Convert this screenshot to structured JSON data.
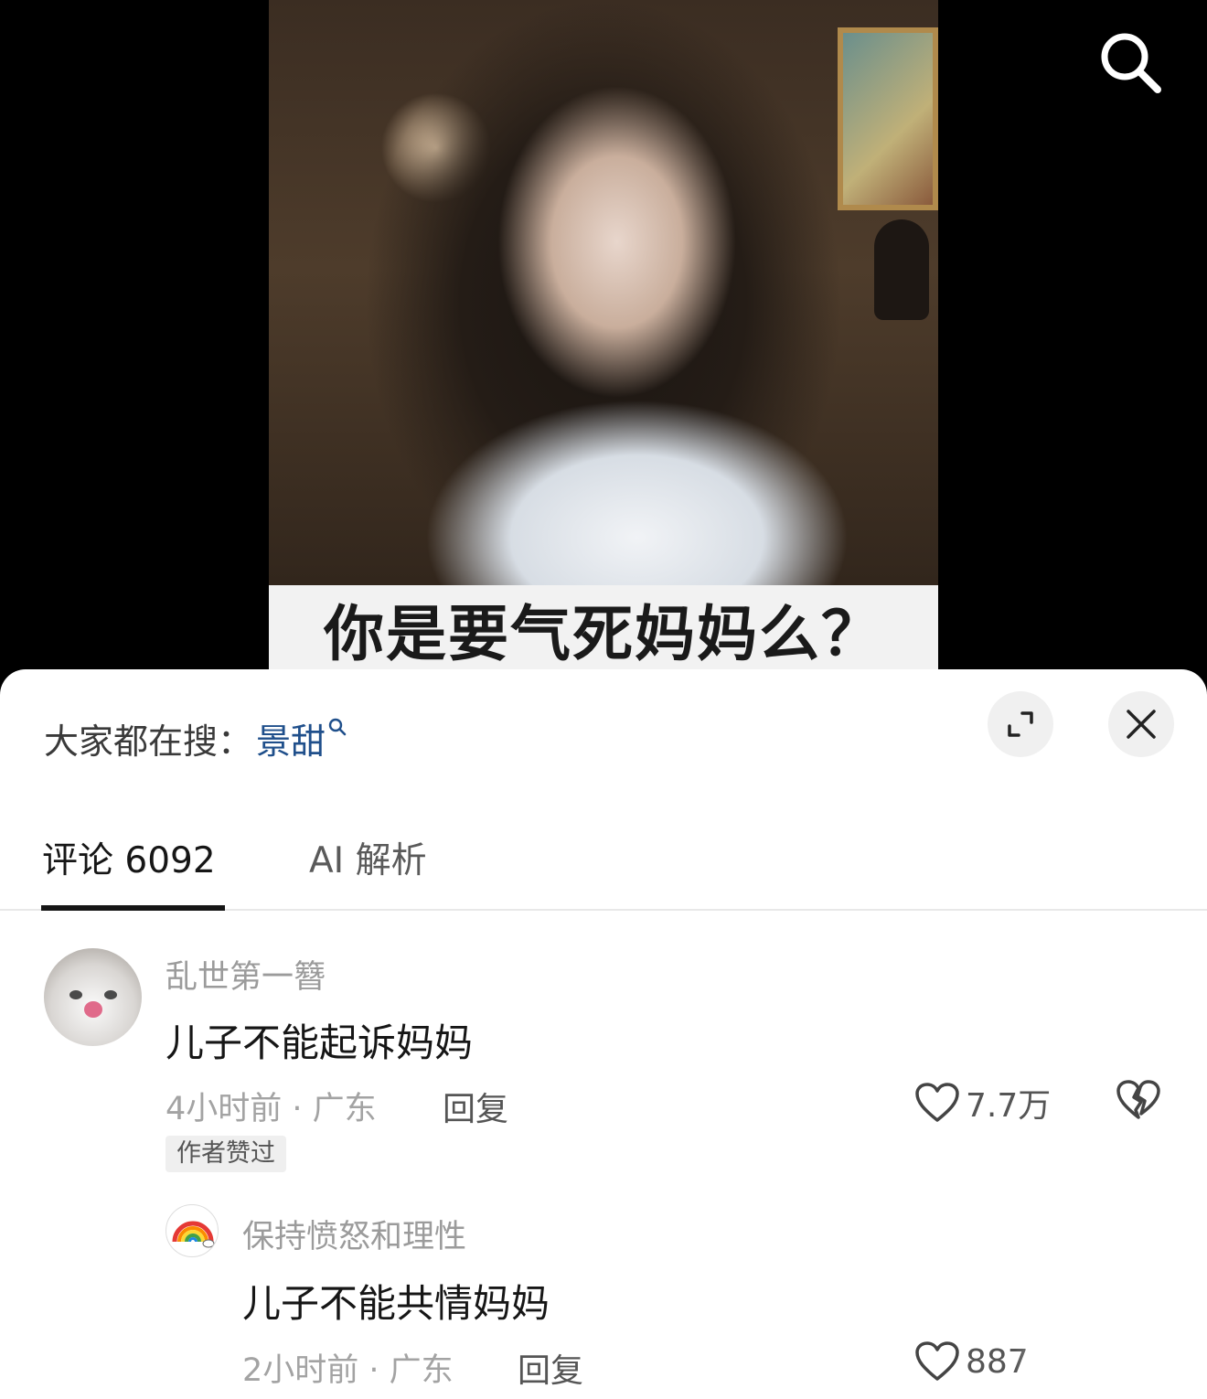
{
  "video": {
    "caption": "你是要气死妈妈么？"
  },
  "sheet": {
    "hot_search_label": "大家都在搜：",
    "hot_search_keyword": "景甜",
    "tabs": [
      {
        "label": "评论 6092",
        "active": true
      },
      {
        "label": "AI 解析",
        "active": false
      }
    ]
  },
  "comments": [
    {
      "username": "乱世第一簪",
      "text": "儿子不能起诉妈妈",
      "meta": "4小时前 · 广东",
      "reply_label": "回复",
      "likes": "7.7万",
      "badge": "作者赞过"
    },
    {
      "username": "保持愤怒和理性",
      "text": "儿子不能共情妈妈",
      "meta": "2小时前 · 广东",
      "reply_label": "回复",
      "likes": "887"
    }
  ],
  "colors": {
    "accent_link": "#1f4f8b",
    "text_primary": "#161616",
    "text_secondary": "#9b9b9b"
  },
  "icons": [
    "search-icon",
    "expand-icon",
    "close-icon",
    "heart-icon",
    "broken-heart-icon",
    "rainbow-icon"
  ]
}
